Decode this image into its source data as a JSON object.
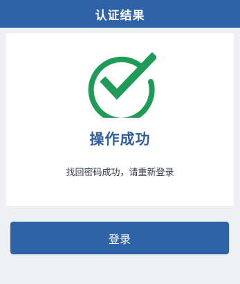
{
  "header": {
    "title": "认证结果"
  },
  "result": {
    "icon": "check-circle-icon",
    "success_color": "#1e9c57",
    "title": "操作成功",
    "message": "找回密码成功，请重新登录"
  },
  "actions": {
    "login_label": "登录"
  },
  "colors": {
    "primary": "#2f63a8",
    "title_text": "#2f5e9f",
    "background": "#eef0f3"
  }
}
